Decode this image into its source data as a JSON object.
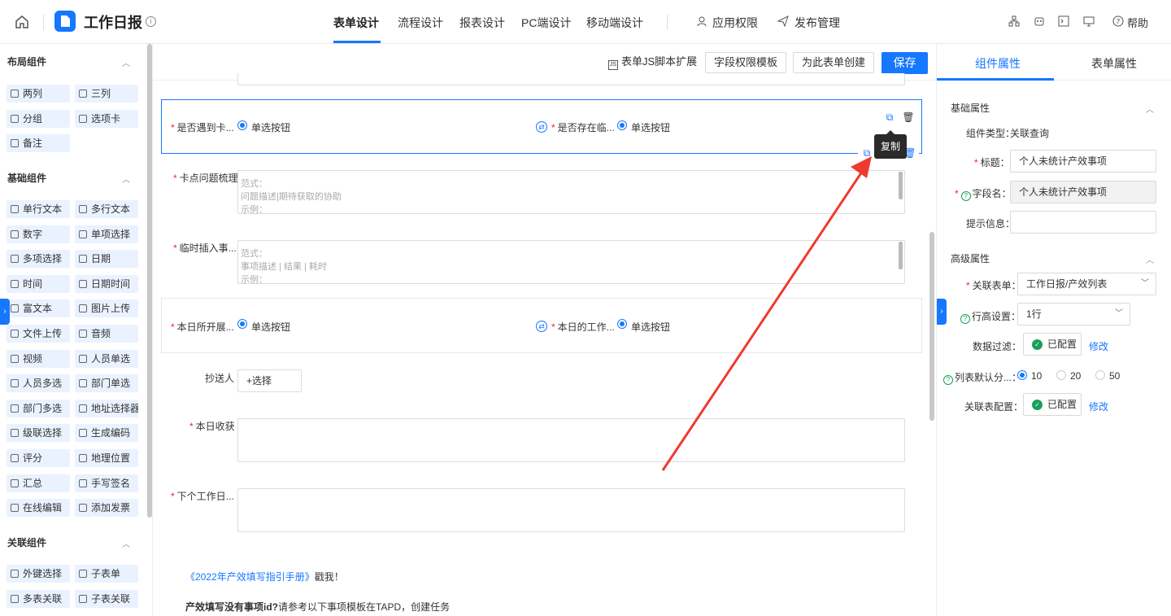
{
  "header": {
    "app_title": "工作日报",
    "tabs": [
      "表单设计",
      "流程设计",
      "报表设计",
      "PC端设计",
      "移动端设计"
    ],
    "right_actions": [
      "应用权限",
      "发布管理"
    ],
    "help_label": "帮助"
  },
  "sidebar": {
    "layout_title": "布局组件",
    "layout_items": [
      "两列",
      "三列",
      "分组",
      "选项卡",
      "备注"
    ],
    "basic_title": "基础组件",
    "basic_items": [
      "单行文本",
      "多行文本",
      "数字",
      "单项选择",
      "多项选择",
      "日期",
      "时间",
      "日期时间",
      "富文本",
      "图片上传",
      "文件上传",
      "音频",
      "视频",
      "人员单选",
      "人员多选",
      "部门单选",
      "部门多选",
      "地址选择器",
      "级联选择",
      "生成编码",
      "评分",
      "地理位置",
      "汇总",
      "手写签名",
      "在线编辑",
      "添加发票"
    ],
    "relation_title": "关联组件",
    "relation_items": [
      "外键选择",
      "子表单",
      "多表关联",
      "子表关联"
    ]
  },
  "toolbar": {
    "js_ext": "表单JS脚本扩展",
    "field_perm": "字段权限模板",
    "create_for_form": "为此表单创建",
    "save": "保存"
  },
  "form": {
    "row1": {
      "label1": "是否遇到卡...",
      "radio1": "单选按钮",
      "label2": "是否存在临...",
      "radio2": "单选按钮"
    },
    "tooltip": "复制",
    "stuck": {
      "label": "卡点问题梳理",
      "lines": [
        "范式：",
        "问题描述|期待获取的协助",
        "示例："
      ]
    },
    "insert": {
      "label": "临时插入事...",
      "lines": [
        "范式：",
        "事项描述 | 结果 | 耗时",
        "示例："
      ]
    },
    "row2": {
      "label1": "本日所开展...",
      "radio1": "单选按钮",
      "label2": "本日的工作...",
      "radio2": "单选按钮"
    },
    "cc": {
      "label": "抄送人",
      "button": "+选择"
    },
    "harvest": {
      "label": "本日收获"
    },
    "next": {
      "label": "下个工作日..."
    },
    "footer": {
      "link": "《2022年产效填写指引手册》",
      "link_suffix": "戳我！",
      "question": "产效填写没有事项id?",
      "question_rest": "请参考以下事项模板在TAPD，创建任务"
    }
  },
  "right_panel": {
    "tab_component": "组件属性",
    "tab_form": "表单属性",
    "basic_title": "基础属性",
    "type_label": "组件类型：",
    "type_value": "关联查询",
    "title_label": "标题：",
    "title_value": "个人未统计产效事项",
    "field_label": "字段名：",
    "field_value": "个人未统计产效事项",
    "hint_label": "提示信息：",
    "hint_value": "",
    "advanced_title": "高级属性",
    "rel_form_label": "关联表单：",
    "rel_form_value": "工作日报/产效列表",
    "row_height_label": "行高设置：",
    "row_height_value": "1行",
    "filter_label": "数据过滤：",
    "configured": "已配置",
    "modify": "修改",
    "page_label": "列表默认分...：",
    "page_options": [
      "10",
      "20",
      "50"
    ],
    "page_selected": "10",
    "rel_config_label": "关联表配置："
  },
  "colors": {
    "accent": "#1677ff",
    "success": "#18a058",
    "annotation_arrow": "#f03a2e"
  }
}
